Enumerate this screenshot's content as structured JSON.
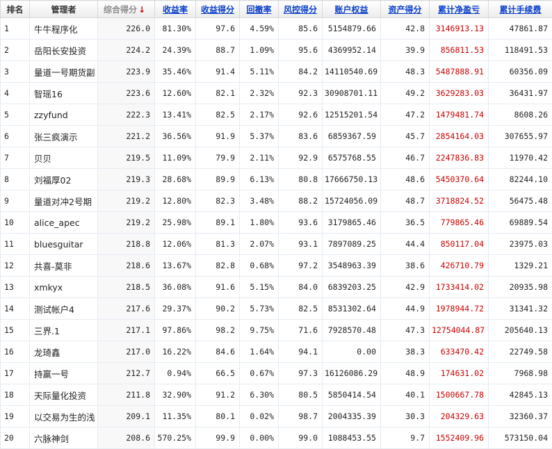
{
  "headers": {
    "rank": "排名",
    "manager": "管理者",
    "total_score": "综合得分",
    "sort_arrow": "↓",
    "return_rate": "收益率",
    "return_score": "收益得分",
    "drawdown": "回撤率",
    "risk_score": "风控得分",
    "equity": "账户权益",
    "asset_score": "资产得分",
    "cum_pnl": "累计净盈亏",
    "cum_fee": "累计手续费"
  },
  "rows": [
    {
      "rank": "1",
      "name": "牛牛程序化",
      "total": "226.0",
      "ret": "81.30%",
      "ret_score": "97.6",
      "dd": "4.59%",
      "risk": "85.6",
      "equity": "5154879.66",
      "asset": "42.8",
      "pnl": "3146913.13",
      "fee": "47861.87"
    },
    {
      "rank": "2",
      "name": "岳阳长安投资",
      "total": "224.2",
      "ret": "24.39%",
      "ret_score": "88.7",
      "dd": "1.09%",
      "risk": "95.6",
      "equity": "4369952.14",
      "asset": "39.9",
      "pnl": "856811.53",
      "fee": "118491.53"
    },
    {
      "rank": "3",
      "name": "量道一号期货副",
      "total": "223.9",
      "ret": "35.46%",
      "ret_score": "91.4",
      "dd": "5.11%",
      "risk": "84.2",
      "equity": "14110540.69",
      "asset": "48.3",
      "pnl": "5487888.91",
      "fee": "60356.09"
    },
    {
      "rank": "4",
      "name": "智瑶16",
      "total": "223.6",
      "ret": "12.60%",
      "ret_score": "82.1",
      "dd": "2.32%",
      "risk": "92.3",
      "equity": "30908701.11",
      "asset": "49.2",
      "pnl": "3629283.03",
      "fee": "36431.97"
    },
    {
      "rank": "5",
      "name": "zzyfund",
      "total": "222.3",
      "ret": "13.41%",
      "ret_score": "82.5",
      "dd": "2.17%",
      "risk": "92.6",
      "equity": "12515201.54",
      "asset": "47.2",
      "pnl": "1479481.74",
      "fee": "8608.26"
    },
    {
      "rank": "6",
      "name": "张三疯演示",
      "total": "221.2",
      "ret": "36.56%",
      "ret_score": "91.9",
      "dd": "5.37%",
      "risk": "83.6",
      "equity": "6859367.59",
      "asset": "45.7",
      "pnl": "2854164.03",
      "fee": "307655.97"
    },
    {
      "rank": "7",
      "name": "贝贝",
      "total": "219.5",
      "ret": "11.09%",
      "ret_score": "79.9",
      "dd": "2.11%",
      "risk": "92.9",
      "equity": "6575768.55",
      "asset": "46.7",
      "pnl": "2247836.83",
      "fee": "11970.42"
    },
    {
      "rank": "8",
      "name": "刘福厚02",
      "total": "219.3",
      "ret": "28.68%",
      "ret_score": "89.9",
      "dd": "6.13%",
      "risk": "80.8",
      "equity": "17666750.13",
      "asset": "48.6",
      "pnl": "5450370.64",
      "fee": "82244.10"
    },
    {
      "rank": "9",
      "name": "量道对冲2号期",
      "total": "219.2",
      "ret": "12.80%",
      "ret_score": "82.3",
      "dd": "3.48%",
      "risk": "88.2",
      "equity": "15724056.09",
      "asset": "48.7",
      "pnl": "3718824.52",
      "fee": "56475.48"
    },
    {
      "rank": "10",
      "name": "alice_apec",
      "total": "219.2",
      "ret": "25.98%",
      "ret_score": "89.1",
      "dd": "1.80%",
      "risk": "93.6",
      "equity": "3179865.46",
      "asset": "36.5",
      "pnl": "779865.46",
      "fee": "69889.54"
    },
    {
      "rank": "11",
      "name": "bluesguitar",
      "total": "218.8",
      "ret": "12.06%",
      "ret_score": "81.3",
      "dd": "2.07%",
      "risk": "93.1",
      "equity": "7897089.25",
      "asset": "44.4",
      "pnl": "850117.04",
      "fee": "23975.03"
    },
    {
      "rank": "12",
      "name": "共喜-莫非",
      "total": "218.6",
      "ret": "13.67%",
      "ret_score": "82.8",
      "dd": "0.68%",
      "risk": "97.2",
      "equity": "3548963.39",
      "asset": "38.6",
      "pnl": "426710.79",
      "fee": "1329.21"
    },
    {
      "rank": "13",
      "name": "xmkyx",
      "total": "218.5",
      "ret": "36.08%",
      "ret_score": "91.6",
      "dd": "5.15%",
      "risk": "84.0",
      "equity": "6839203.25",
      "asset": "42.9",
      "pnl": "1733414.02",
      "fee": "20935.98"
    },
    {
      "rank": "14",
      "name": "测试帐户4",
      "total": "217.6",
      "ret": "29.37%",
      "ret_score": "90.2",
      "dd": "5.73%",
      "risk": "82.5",
      "equity": "8531302.64",
      "asset": "44.9",
      "pnl": "1978944.72",
      "fee": "31341.32"
    },
    {
      "rank": "15",
      "name": "三界.1",
      "total": "217.1",
      "ret": "97.86%",
      "ret_score": "98.2",
      "dd": "9.75%",
      "risk": "71.6",
      "equity": "7928570.48",
      "asset": "47.3",
      "pnl": "12754044.87",
      "fee": "205640.13"
    },
    {
      "rank": "16",
      "name": "龙琦鑫",
      "total": "217.0",
      "ret": "16.22%",
      "ret_score": "84.6",
      "dd": "1.64%",
      "risk": "94.1",
      "equity": "0.00",
      "asset": "38.3",
      "pnl": "633470.42",
      "fee": "22749.58"
    },
    {
      "rank": "17",
      "name": "持赢一号",
      "total": "212.7",
      "ret": "0.94%",
      "ret_score": "66.5",
      "dd": "0.67%",
      "risk": "97.3",
      "equity": "16126086.29",
      "asset": "48.9",
      "pnl": "174631.02",
      "fee": "7968.98"
    },
    {
      "rank": "18",
      "name": "天际量化投资",
      "total": "211.8",
      "ret": "32.90%",
      "ret_score": "91.2",
      "dd": "6.30%",
      "risk": "80.5",
      "equity": "5850414.54",
      "asset": "40.1",
      "pnl": "1500667.78",
      "fee": "42845.13"
    },
    {
      "rank": "19",
      "name": "以交易为生的浅",
      "total": "209.1",
      "ret": "11.35%",
      "ret_score": "80.1",
      "dd": "0.02%",
      "risk": "98.7",
      "equity": "2004335.39",
      "asset": "30.3",
      "pnl": "204329.63",
      "fee": "32360.37"
    },
    {
      "rank": "20",
      "name": "六脉神剑",
      "total": "208.6",
      "ret": "570.25%",
      "ret_score": "99.9",
      "dd": "0.00%",
      "risk": "99.0",
      "equity": "1088453.55",
      "asset": "9.7",
      "pnl": "1552409.96",
      "fee": "573150.04"
    }
  ],
  "colors": {
    "link": "#0a3fcc",
    "negative": "#cc0000",
    "border": "#e4ebf3"
  }
}
